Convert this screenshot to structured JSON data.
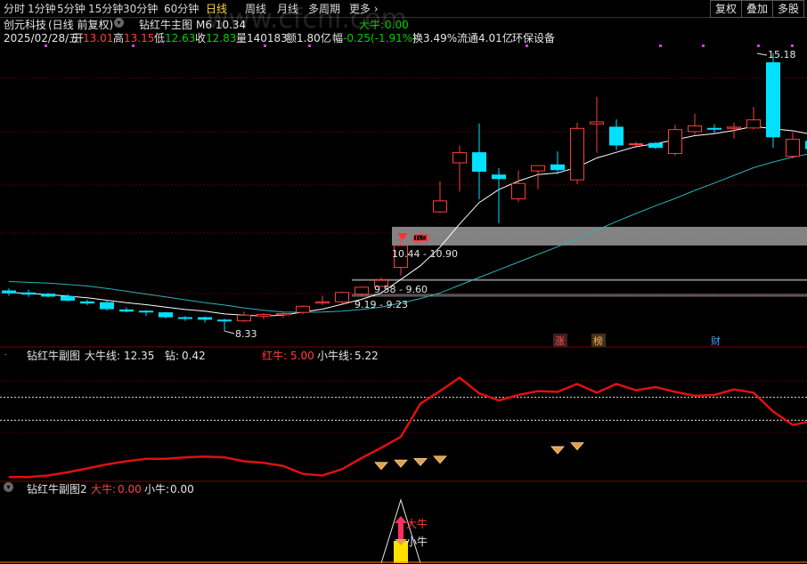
{
  "toolbar": {
    "periods": [
      "分时",
      "1分钟",
      "5分钟",
      "15分钟",
      "30分钟",
      "60分钟",
      "日线",
      "周线",
      "月线",
      "多周期",
      "更多"
    ],
    "active_period": "日线",
    "right_buttons": [
      "复权",
      "叠加",
      "多股"
    ]
  },
  "watermark": "www.cfchi.com",
  "header": {
    "stock_name": "创元科技",
    "mode": "(日线 前复权)",
    "indicator_name": "钻红牛主图",
    "indicator_extra": "M6 10.34",
    "da_niu_label": "大牛:",
    "da_niu_value": "0.00"
  },
  "quote": {
    "date": "2025/02/28/五",
    "open_label": "开",
    "open": "13.01",
    "high_label": "高",
    "high": "13.15",
    "low_label": "低",
    "low": "12.63",
    "close_label": "收",
    "close": "12.83",
    "volume_label": "量",
    "volume": "140183",
    "amount_label": "额",
    "amount": "1.80亿",
    "change_label": "幅",
    "change": "-0.25(-1.91%)",
    "turnover_label": "换",
    "turnover": "3.49%",
    "float_label": "流通",
    "float": "4.01亿",
    "sector": "环保设备"
  },
  "main_annotations": {
    "max_price": "15.18",
    "min_price": "8.33",
    "zone1": "10.44 - 10.90",
    "zone2": "9.58 - 9.60",
    "zone3": "9.19 - 9.23",
    "xiao_niu_tag": "小牛",
    "badge_zhang": "涨",
    "badge_bang": "榜",
    "badge_cai": "财"
  },
  "sub1": {
    "name": "钻红牛副图",
    "da_niu_xian_label": "大牛线:",
    "da_niu_xian": "12.35",
    "zuan_label": "钻:",
    "zuan": "0.42",
    "hong_niu_label": "红牛:",
    "hong_niu": "5.00",
    "xiao_niu_xian_label": "小牛线:",
    "xiao_niu_xian": "5.22"
  },
  "sub2": {
    "name": "钻红牛副图2",
    "da_niu_label": "大牛:",
    "da_niu": "0.00",
    "xiao_niu_label": "小牛:",
    "xiao_niu": "0.00",
    "tag_da": "大牛",
    "tag_xiao": "小牛"
  },
  "colors": {
    "up": "#ff3c3c",
    "down": "#00e0ff",
    "ma_short": "#ffffff",
    "ma_long": "#2bb3b3",
    "red_line": "#e01010",
    "dashed": "#e8e8d0",
    "grid": "#550000",
    "zone": "#9a9a9a"
  },
  "chart_data": {
    "type": "candlestick",
    "candles": [
      {
        "o": 9.32,
        "h": 9.38,
        "l": 9.2,
        "c": 9.27
      },
      {
        "o": 9.27,
        "h": 9.35,
        "l": 9.17,
        "c": 9.24
      },
      {
        "o": 9.24,
        "h": 9.27,
        "l": 9.16,
        "c": 9.19
      },
      {
        "o": 9.18,
        "h": 9.24,
        "l": 9.06,
        "c": 9.09
      },
      {
        "o": 9.05,
        "h": 9.1,
        "l": 8.97,
        "c": 9.02
      },
      {
        "o": 9.03,
        "h": 9.09,
        "l": 8.83,
        "c": 8.88
      },
      {
        "o": 8.85,
        "h": 8.91,
        "l": 8.79,
        "c": 8.82
      },
      {
        "o": 8.82,
        "h": 8.85,
        "l": 8.7,
        "c": 8.81
      },
      {
        "o": 8.78,
        "h": 8.8,
        "l": 8.64,
        "c": 8.68
      },
      {
        "o": 8.66,
        "h": 8.7,
        "l": 8.58,
        "c": 8.64
      },
      {
        "o": 8.66,
        "h": 8.69,
        "l": 8.54,
        "c": 8.62
      },
      {
        "o": 8.6,
        "h": 8.63,
        "l": 8.33,
        "c": 8.58
      },
      {
        "o": 8.58,
        "h": 8.81,
        "l": 8.55,
        "c": 8.72
      },
      {
        "o": 8.7,
        "h": 8.77,
        "l": 8.62,
        "c": 8.74
      },
      {
        "o": 8.73,
        "h": 8.8,
        "l": 8.66,
        "c": 8.76
      },
      {
        "o": 8.79,
        "h": 8.96,
        "l": 8.74,
        "c": 8.94
      },
      {
        "o": 9.02,
        "h": 9.2,
        "l": 8.97,
        "c": 9.05
      },
      {
        "o": 9.05,
        "h": 9.3,
        "l": 9.01,
        "c": 9.28
      },
      {
        "o": 9.24,
        "h": 9.43,
        "l": 9.19,
        "c": 9.41
      },
      {
        "o": 9.43,
        "h": 9.65,
        "l": 9.42,
        "c": 9.58
      },
      {
        "o": 9.9,
        "h": 10.6,
        "l": 9.7,
        "c": 10.44
      },
      {
        "o": 10.56,
        "h": 10.82,
        "l": 10.44,
        "c": 10.7
      },
      {
        "o": 11.27,
        "h": 12.02,
        "l": 11.24,
        "c": 11.54
      },
      {
        "o": 12.48,
        "h": 12.9,
        "l": 11.77,
        "c": 12.73
      },
      {
        "o": 12.73,
        "h": 13.45,
        "l": 11.58,
        "c": 12.27
      },
      {
        "o": 12.18,
        "h": 12.35,
        "l": 10.99,
        "c": 12.09
      },
      {
        "o": 11.59,
        "h": 12.29,
        "l": 11.51,
        "c": 11.97
      },
      {
        "o": 12.28,
        "h": 12.34,
        "l": 11.83,
        "c": 12.41
      },
      {
        "o": 12.43,
        "h": 12.76,
        "l": 12.2,
        "c": 12.31
      },
      {
        "o": 12.06,
        "h": 13.47,
        "l": 11.95,
        "c": 13.33
      },
      {
        "o": 13.44,
        "h": 14.11,
        "l": 12.73,
        "c": 13.49
      },
      {
        "o": 13.36,
        "h": 13.55,
        "l": 12.8,
        "c": 12.92
      },
      {
        "o": 12.93,
        "h": 13.0,
        "l": 12.84,
        "c": 12.95
      },
      {
        "o": 12.96,
        "h": 12.99,
        "l": 12.82,
        "c": 12.86
      },
      {
        "o": 12.71,
        "h": 13.42,
        "l": 12.66,
        "c": 13.3
      },
      {
        "o": 13.25,
        "h": 13.69,
        "l": 13.18,
        "c": 13.39
      },
      {
        "o": 13.33,
        "h": 13.43,
        "l": 13.19,
        "c": 13.32
      },
      {
        "o": 13.33,
        "h": 13.47,
        "l": 13.08,
        "c": 13.36
      },
      {
        "o": 13.34,
        "h": 13.86,
        "l": 13.31,
        "c": 13.54
      },
      {
        "o": 14.95,
        "h": 15.18,
        "l": 12.85,
        "c": 13.12
      },
      {
        "o": 12.64,
        "h": 13.23,
        "l": 12.59,
        "c": 13.06
      },
      {
        "o": 13.01,
        "h": 13.15,
        "l": 12.63,
        "c": 12.83
      }
    ],
    "ma_short": [
      9.28,
      9.26,
      9.23,
      9.19,
      9.15,
      9.09,
      9.03,
      8.98,
      8.92,
      8.86,
      8.82,
      8.75,
      8.72,
      8.7,
      8.72,
      8.8,
      8.87,
      8.99,
      9.11,
      9.27,
      9.6,
      9.94,
      10.4,
      10.97,
      11.5,
      11.82,
      12.03,
      12.19,
      12.23,
      12.37,
      12.6,
      12.74,
      12.88,
      12.95,
      13.05,
      13.15,
      13.2,
      13.28,
      13.38,
      13.32,
      13.27,
      13.18
    ],
    "ma_long": [
      9.55,
      9.53,
      9.51,
      9.48,
      9.44,
      9.38,
      9.31,
      9.24,
      9.17,
      9.1,
      9.03,
      8.97,
      8.9,
      8.84,
      8.8,
      8.79,
      8.8,
      8.82,
      8.86,
      8.92,
      9.02,
      9.13,
      9.27,
      9.46,
      9.65,
      9.84,
      10.03,
      10.22,
      10.41,
      10.6,
      10.82,
      11.03,
      11.23,
      11.42,
      11.6,
      11.8,
      11.98,
      12.17,
      12.36,
      12.5,
      12.62,
      12.72
    ],
    "price_ylim": [
      8.2,
      15.4
    ],
    "sub1_red_line": [
      0.2,
      0.2,
      0.4,
      0.8,
      1.3,
      1.8,
      2.2,
      2.5,
      2.5,
      2.7,
      2.8,
      2.7,
      2.2,
      2.0,
      1.6,
      0.6,
      0.4,
      1.2,
      2.6,
      3.9,
      5.3,
      9.5,
      11.1,
      12.8,
      10.8,
      9.9,
      10.6,
      11.1,
      11.0,
      12.0,
      10.9,
      12.0,
      11.2,
      11.6,
      11.0,
      10.5,
      10.6,
      11.3,
      10.9,
      8.5,
      6.8,
      7.3
    ],
    "sub1_dashed_upper": 10.3,
    "sub1_dashed_lower": 7.4,
    "sub1_ylim": [
      0,
      15
    ],
    "sub1_diamonds": [
      {
        "i": 19,
        "v": 1.6
      },
      {
        "i": 20,
        "v": 1.9
      },
      {
        "i": 21,
        "v": 2.1
      },
      {
        "i": 22,
        "v": 2.4
      },
      {
        "i": 28,
        "v": 3.6
      },
      {
        "i": 29,
        "v": 4.1
      }
    ],
    "sub2_signal_index": 20
  }
}
